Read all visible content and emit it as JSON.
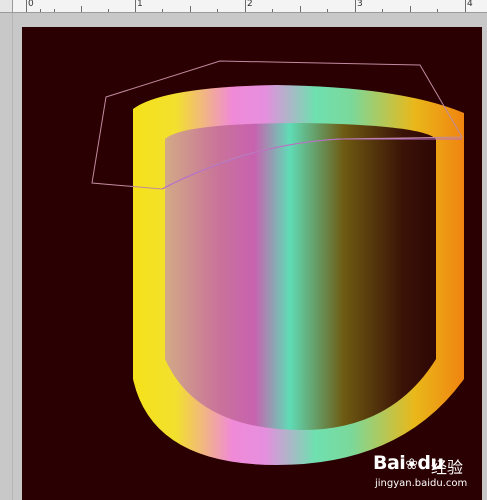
{
  "ruler": {
    "labels": [
      "0",
      "1",
      "2",
      "3",
      "4"
    ]
  },
  "canvas": {
    "background": "#2a0002"
  },
  "artwork": {
    "outer_gradient": [
      "#f5e21b",
      "#f2e02e",
      "#f08ad8",
      "#e58fde",
      "#6fe0b0",
      "#7bd89a",
      "#e9b81a",
      "#f08410"
    ],
    "inner_gradient": [
      "#d2aa86",
      "#c9729a",
      "#c862b0",
      "#5fdcb6",
      "#6e5a12",
      "#3a1206",
      "#2e0705"
    ],
    "path_stroke": "#c08aa0"
  },
  "watermark": {
    "logo": "Bai",
    "paw": "❀",
    "logo_tail": "du",
    "cn": "经验",
    "url": "jingyan.baidu.com"
  }
}
